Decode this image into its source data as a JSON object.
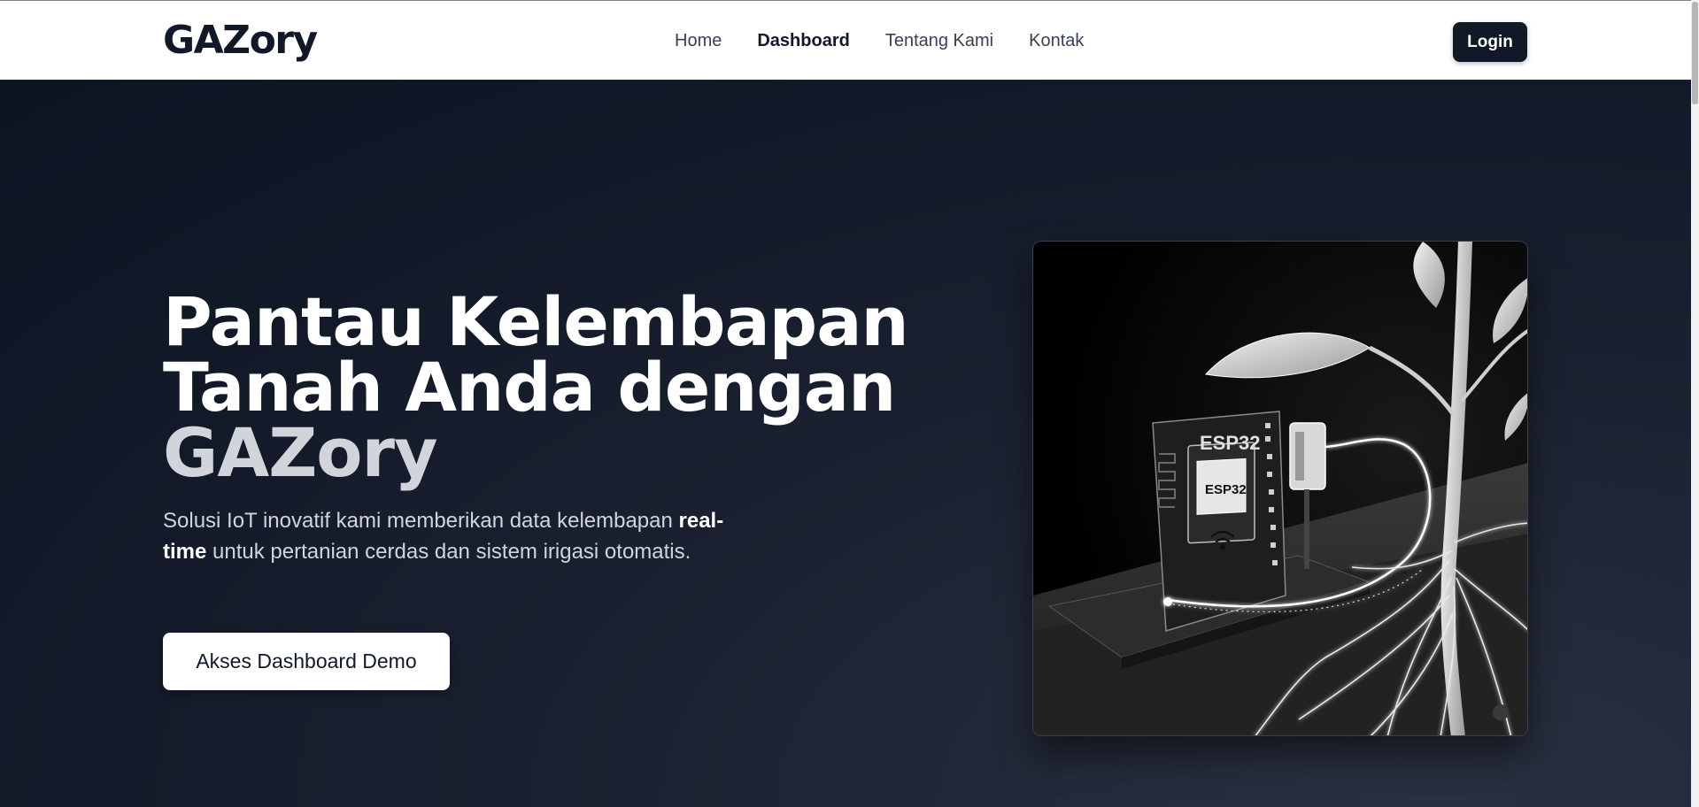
{
  "header": {
    "brand": "GAZory",
    "nav": [
      {
        "label": "Home",
        "active": false
      },
      {
        "label": "Dashboard",
        "active": true
      },
      {
        "label": "Tentang Kami",
        "active": false
      },
      {
        "label": "Kontak",
        "active": false
      }
    ],
    "login_label": "Login"
  },
  "hero": {
    "title_line1": "Pantau Kelembapan",
    "title_line2": "Tanah Anda dengan",
    "title_line3": "GAZory",
    "desc_part1": "Solusi IoT inovatif kami memberikan data kelembapan ",
    "desc_bold": "real-time",
    "desc_part2": " untuk pertanian cerdas dan sistem irigasi otomatis.",
    "cta_label": "Akses Dashboard Demo",
    "image": {
      "chip_label_board": "ESP32",
      "chip_label_module": "ESP32"
    }
  },
  "colors": {
    "hero_bg": "#111827",
    "header_bg": "#ffffff",
    "primary": "#111827"
  }
}
